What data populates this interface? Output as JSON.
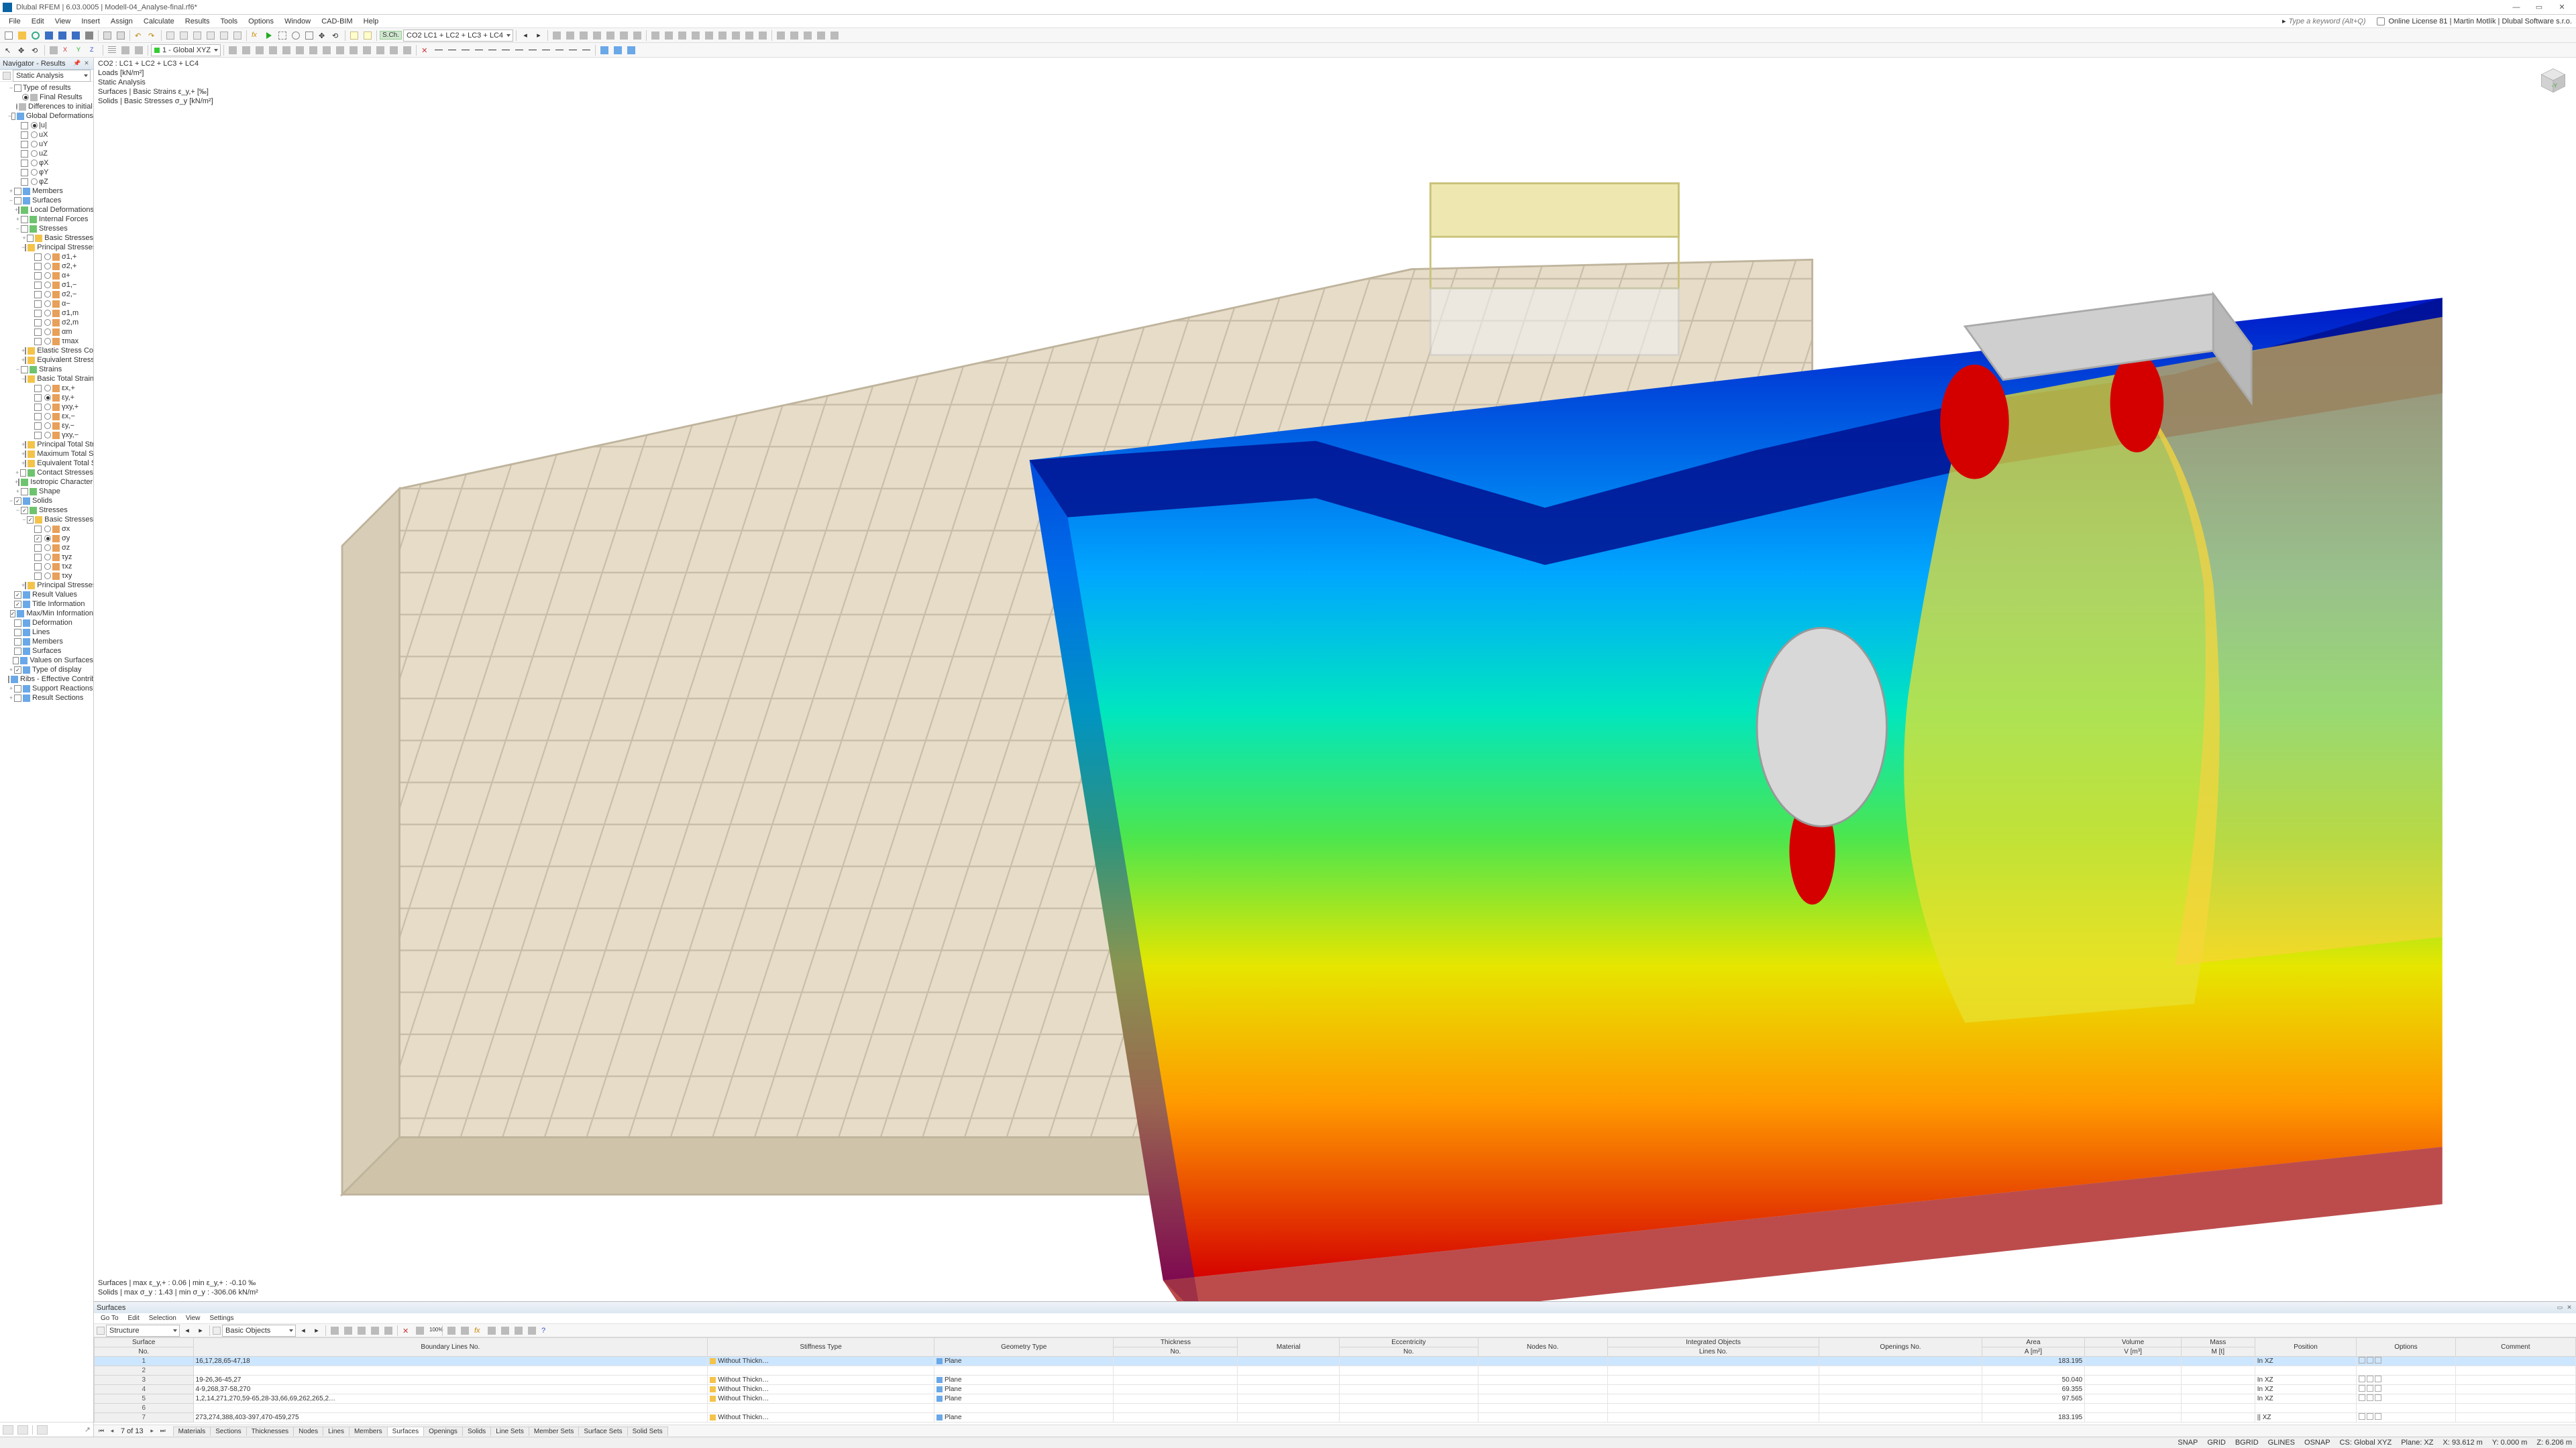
{
  "app_title": "Dlubal RFEM | 6.03.0005 | Modell-04_Analyse-final.rf6*",
  "menu": [
    "File",
    "Edit",
    "View",
    "Insert",
    "Assign",
    "Calculate",
    "Results",
    "Tools",
    "Options",
    "Window",
    "CAD-BIM",
    "Help"
  ],
  "search_placeholder": "Type a keyword (Alt+Q)",
  "license_text": "Online License 81 | Martin Motlík | Dlubal Software s.r.o.",
  "toolbar2_combo1": "CO2   LC1 + LC2 + LC3 + LC4",
  "toolbar2_prefix": "S.Ch.",
  "toolbar2_combo_cs": "1 - Global XYZ",
  "nav_title": "Navigator - Results",
  "nav_combo": "Static Analysis",
  "tree": [
    {
      "d": 0,
      "tw": "−",
      "ck": false,
      "lbl": "Type of results"
    },
    {
      "d": 1,
      "rad": true,
      "ic": "c-grey",
      "lbl": "Final Results"
    },
    {
      "d": 1,
      "rad": false,
      "ic": "c-grey",
      "lbl": "Differences to initial state"
    },
    {
      "d": 0,
      "tw": "−",
      "ck": false,
      "ic": "c-blue",
      "lbl": "Global Deformations"
    },
    {
      "d": 1,
      "rad": true,
      "ck": false,
      "lbl": "|u|"
    },
    {
      "d": 1,
      "rad": false,
      "ck": false,
      "lbl": "uX"
    },
    {
      "d": 1,
      "rad": false,
      "ck": false,
      "lbl": "uY"
    },
    {
      "d": 1,
      "rad": false,
      "ck": false,
      "lbl": "uZ"
    },
    {
      "d": 1,
      "rad": false,
      "ck": false,
      "lbl": "φX"
    },
    {
      "d": 1,
      "rad": false,
      "ck": false,
      "lbl": "φY"
    },
    {
      "d": 1,
      "rad": false,
      "ck": false,
      "lbl": "φZ"
    },
    {
      "d": 0,
      "tw": "+",
      "ck": false,
      "ic": "c-blue",
      "lbl": "Members"
    },
    {
      "d": 0,
      "tw": "−",
      "ck": false,
      "ic": "c-blue",
      "lbl": "Surfaces"
    },
    {
      "d": 1,
      "tw": "+",
      "ck": false,
      "ic": "c-green",
      "lbl": "Local Deformations"
    },
    {
      "d": 1,
      "tw": "+",
      "ck": false,
      "ic": "c-green",
      "lbl": "Internal Forces"
    },
    {
      "d": 1,
      "tw": "−",
      "ck": false,
      "ic": "c-green",
      "lbl": "Stresses"
    },
    {
      "d": 2,
      "tw": "+",
      "ck": false,
      "ic": "c-folder",
      "lbl": "Basic Stresses"
    },
    {
      "d": 2,
      "tw": "−",
      "ck": false,
      "ic": "c-folder",
      "lbl": "Principal Stresses"
    },
    {
      "d": 3,
      "rad": false,
      "ck": false,
      "ic": "c-orange",
      "lbl": "σ1,+"
    },
    {
      "d": 3,
      "rad": false,
      "ck": false,
      "ic": "c-orange",
      "lbl": "σ2,+"
    },
    {
      "d": 3,
      "rad": false,
      "ck": false,
      "ic": "c-orange",
      "lbl": "α+"
    },
    {
      "d": 3,
      "rad": false,
      "ck": false,
      "ic": "c-orange",
      "lbl": "σ1,−"
    },
    {
      "d": 3,
      "rad": false,
      "ck": false,
      "ic": "c-orange",
      "lbl": "σ2,−"
    },
    {
      "d": 3,
      "rad": false,
      "ck": false,
      "ic": "c-orange",
      "lbl": "α−"
    },
    {
      "d": 3,
      "rad": false,
      "ck": false,
      "ic": "c-orange",
      "lbl": "σ1,m"
    },
    {
      "d": 3,
      "rad": false,
      "ck": false,
      "ic": "c-orange",
      "lbl": "σ2,m"
    },
    {
      "d": 3,
      "rad": false,
      "ck": false,
      "ic": "c-orange",
      "lbl": "αm"
    },
    {
      "d": 3,
      "rad": false,
      "ck": false,
      "ic": "c-orange",
      "lbl": "τmax"
    },
    {
      "d": 2,
      "tw": "+",
      "ck": false,
      "ic": "c-folder",
      "lbl": "Elastic Stress Components"
    },
    {
      "d": 2,
      "tw": "+",
      "ck": false,
      "ic": "c-folder",
      "lbl": "Equivalent Stresses"
    },
    {
      "d": 1,
      "tw": "−",
      "ck": false,
      "ic": "c-green",
      "lbl": "Strains"
    },
    {
      "d": 2,
      "tw": "−",
      "ck": false,
      "ic": "c-folder",
      "lbl": "Basic Total Strains"
    },
    {
      "d": 3,
      "rad": false,
      "ck": false,
      "ic": "c-orange",
      "lbl": "εx,+"
    },
    {
      "d": 3,
      "rad": true,
      "ck": false,
      "ic": "c-orange",
      "lbl": "εy,+"
    },
    {
      "d": 3,
      "rad": false,
      "ck": false,
      "ic": "c-orange",
      "lbl": "γxy,+"
    },
    {
      "d": 3,
      "rad": false,
      "ck": false,
      "ic": "c-orange",
      "lbl": "εx,−"
    },
    {
      "d": 3,
      "rad": false,
      "ck": false,
      "ic": "c-orange",
      "lbl": "εy,−"
    },
    {
      "d": 3,
      "rad": false,
      "ck": false,
      "ic": "c-orange",
      "lbl": "γxy,−"
    },
    {
      "d": 2,
      "tw": "+",
      "ck": false,
      "ic": "c-folder",
      "lbl": "Principal Total Strains"
    },
    {
      "d": 2,
      "tw": "+",
      "ck": false,
      "ic": "c-folder",
      "lbl": "Maximum Total Strains"
    },
    {
      "d": 2,
      "tw": "+",
      "ck": false,
      "ic": "c-folder",
      "lbl": "Equivalent Total Strains"
    },
    {
      "d": 1,
      "tw": "+",
      "ck": false,
      "ic": "c-green",
      "lbl": "Contact Stresses"
    },
    {
      "d": 1,
      "tw": "+",
      "ck": false,
      "ic": "c-green",
      "lbl": "Isotropic Characteristics"
    },
    {
      "d": 1,
      "tw": "+",
      "ck": false,
      "ic": "c-green",
      "lbl": "Shape"
    },
    {
      "d": 0,
      "tw": "−",
      "ck": true,
      "ic": "c-blue",
      "lbl": "Solids"
    },
    {
      "d": 1,
      "tw": "−",
      "ck": true,
      "ic": "c-green",
      "lbl": "Stresses"
    },
    {
      "d": 2,
      "tw": "−",
      "ck": true,
      "ic": "c-folder",
      "lbl": "Basic Stresses"
    },
    {
      "d": 3,
      "rad": false,
      "ck": false,
      "ic": "c-orange",
      "lbl": "σx"
    },
    {
      "d": 3,
      "rad": true,
      "ck": true,
      "ic": "c-orange",
      "lbl": "σy"
    },
    {
      "d": 3,
      "rad": false,
      "ck": false,
      "ic": "c-orange",
      "lbl": "σz"
    },
    {
      "d": 3,
      "rad": false,
      "ck": false,
      "ic": "c-orange",
      "lbl": "τyz"
    },
    {
      "d": 3,
      "rad": false,
      "ck": false,
      "ic": "c-orange",
      "lbl": "τxz"
    },
    {
      "d": 3,
      "rad": false,
      "ck": false,
      "ic": "c-orange",
      "lbl": "τxy"
    },
    {
      "d": 2,
      "tw": "+",
      "ck": false,
      "ic": "c-folder",
      "lbl": "Principal Stresses"
    },
    {
      "d": 0,
      "ck": true,
      "ic": "c-blue",
      "lbl": "Result Values"
    },
    {
      "d": 0,
      "ck": true,
      "ic": "c-blue",
      "lbl": "Title Information"
    },
    {
      "d": 0,
      "ck": true,
      "ic": "c-blue",
      "lbl": "Max/Min Information"
    },
    {
      "d": 0,
      "ck": false,
      "ic": "c-blue",
      "lbl": "Deformation"
    },
    {
      "d": 0,
      "ck": false,
      "ic": "c-blue",
      "lbl": "Lines"
    },
    {
      "d": 0,
      "ck": false,
      "ic": "c-blue",
      "lbl": "Members"
    },
    {
      "d": 0,
      "ck": false,
      "ic": "c-blue",
      "lbl": "Surfaces"
    },
    {
      "d": 0,
      "ck": false,
      "ic": "c-blue",
      "lbl": "Values on Surfaces"
    },
    {
      "d": 0,
      "tw": "+",
      "ck": true,
      "ic": "c-blue",
      "lbl": "Type of display"
    },
    {
      "d": 0,
      "ck": false,
      "ic": "c-blue",
      "lbl": "Ribs - Effective Contribution on Surface/…"
    },
    {
      "d": 0,
      "tw": "+",
      "ck": false,
      "ic": "c-blue",
      "lbl": "Support Reactions"
    },
    {
      "d": 0,
      "tw": "+",
      "ck": false,
      "ic": "c-blue",
      "lbl": "Result Sections"
    }
  ],
  "overlay_top": [
    "CO2  :  LC1 + LC2 + LC3 + LC4",
    "Loads [kN/m²]",
    "Static Analysis",
    "Surfaces | Basic Strains ε_y,+  [‰]",
    "Solids | Basic Stresses σ_y  [kN/m²]"
  ],
  "overlay_bottom": [
    "Surfaces | max ε_y,+ : 0.06 | min ε_y,+ : -0.10 ‰",
    "Solids | max σ_y : 1.43 | min σ_y : -306.06 kN/m²"
  ],
  "panel_title": "Surfaces",
  "panel_menu": [
    "Go To",
    "Edit",
    "Selection",
    "View",
    "Settings"
  ],
  "panel_combo1": "Structure",
  "panel_combo2": "Basic Objects",
  "grid_headers_top": [
    "Surface",
    "Boundary Lines No.",
    "Stiffness Type",
    "Geometry Type",
    "Thickness",
    "Material",
    "Eccentricity",
    "Nodes No.",
    "Integrated Objects",
    "Openings No.",
    "Area",
    "Volume",
    "Mass",
    "Position",
    "Options",
    "Comment"
  ],
  "grid_headers_sub": {
    "Surface": "No.",
    "Thickness": "No.",
    "Eccentricity": "No.",
    "Integrated Objects": "Lines No.",
    "Area": "A [m²]",
    "Volume": "V [m³]",
    "Mass": "M [t]"
  },
  "rows": [
    {
      "no": "1",
      "b": "16,17,28,65-47,18",
      "st": "Without Thickn…",
      "gt": "Plane",
      "area": "183.195",
      "pos": "In XZ",
      "sel": true
    },
    {
      "no": "2",
      "b": "",
      "st": "",
      "gt": "",
      "area": "",
      "pos": ""
    },
    {
      "no": "3",
      "b": "19-26,36-45,27",
      "st": "Without Thickn…",
      "gt": "Plane",
      "area": "50.040",
      "pos": "In XZ"
    },
    {
      "no": "4",
      "b": "4-9,268,37-58,270",
      "st": "Without Thickn…",
      "gt": "Plane",
      "area": "69.355",
      "pos": "In XZ"
    },
    {
      "no": "5",
      "b": "1,2,14,271,270,59-65,28-33,66,69,262,265,2…",
      "st": "Without Thickn…",
      "gt": "Plane",
      "area": "97.565",
      "pos": "In XZ"
    },
    {
      "no": "6",
      "b": "",
      "st": "",
      "gt": "",
      "area": "",
      "pos": ""
    },
    {
      "no": "7",
      "b": "273,274,388,403-397,470-459,275",
      "st": "Without Thickn…",
      "gt": "Plane",
      "area": "183.195",
      "pos": "|| XZ"
    }
  ],
  "pager_text": "7 of 13",
  "tabs": [
    "Materials",
    "Sections",
    "Thicknesses",
    "Nodes",
    "Lines",
    "Members",
    "Surfaces",
    "Openings",
    "Solids",
    "Line Sets",
    "Member Sets",
    "Surface Sets",
    "Solid Sets"
  ],
  "active_tab": 6,
  "status_l": [
    "SNAP",
    "GRID",
    "BGRID",
    "GLINES",
    "OSNAP"
  ],
  "status_r": [
    "CS: Global XYZ",
    "Plane: XZ",
    "X: 93.612 m",
    "Y: 0.000 m",
    "Z: 6.206 m"
  ]
}
